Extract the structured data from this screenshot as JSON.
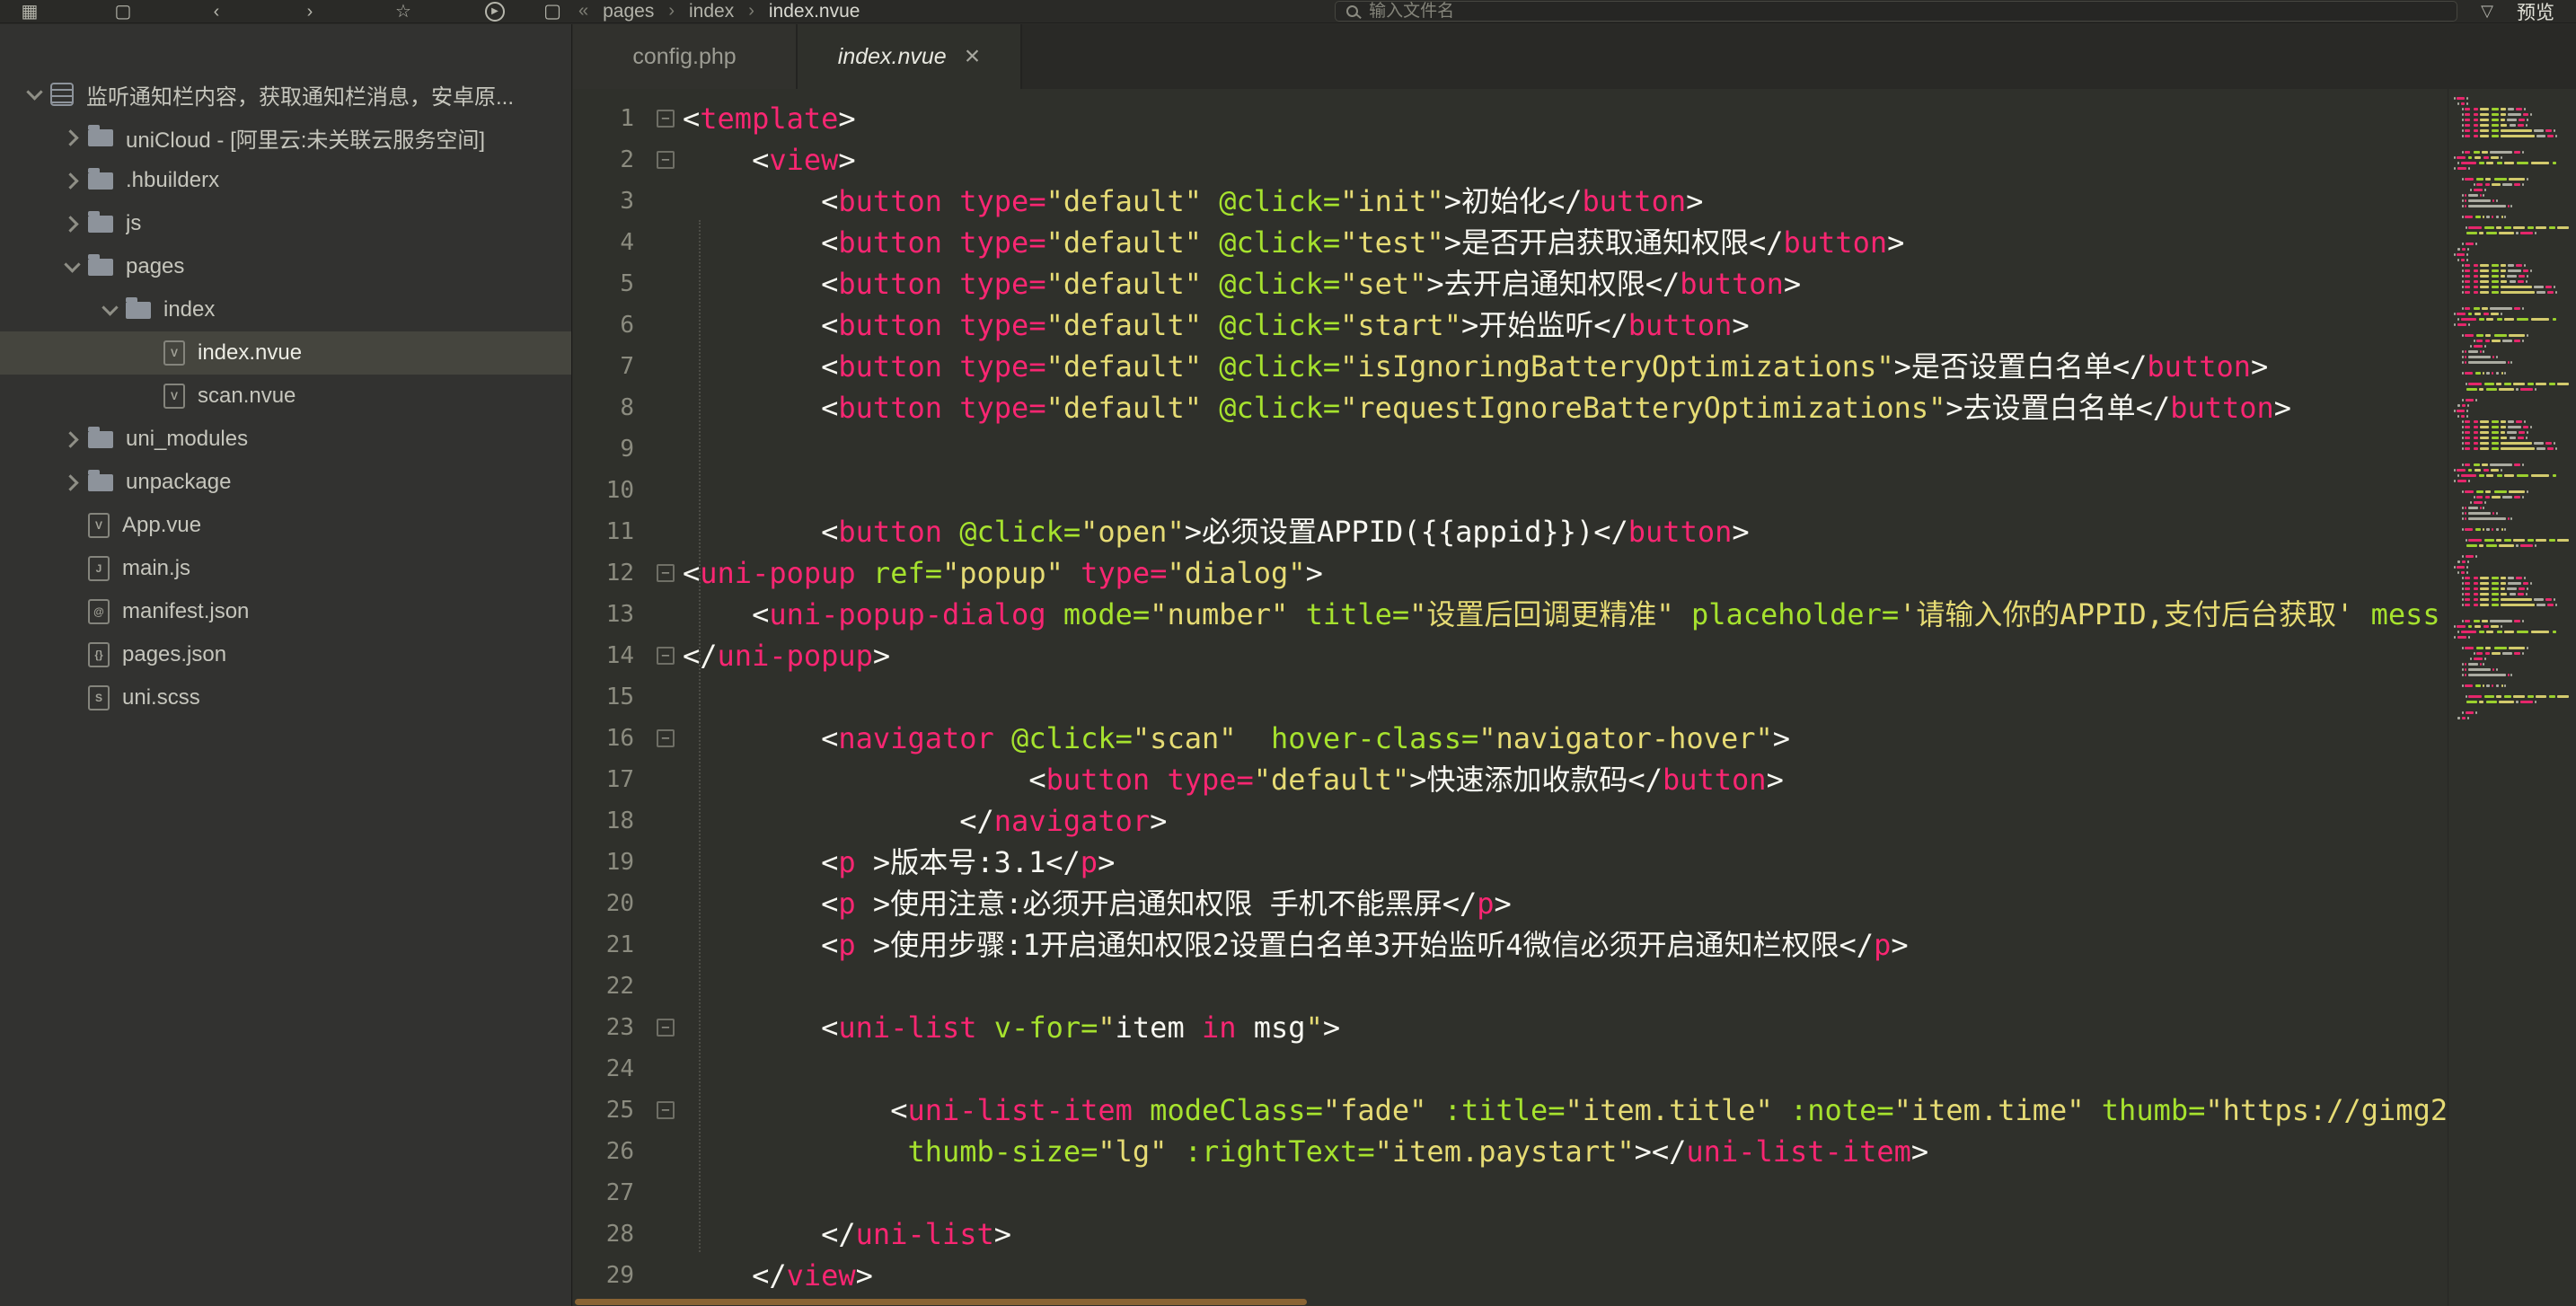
{
  "colors": {
    "tag": "#f92672",
    "attr": "#a6e22e",
    "string": "#e6db74",
    "plain": "#f8f8f2",
    "keyword": "#f92672",
    "lineNumber": "#8b8b7f",
    "editorBg": "#2f302b",
    "sidebarBg": "#323230",
    "selection": "#45453e",
    "scrollbar": "#8a6434"
  },
  "icons": {
    "grid": "▦",
    "doc": "▢",
    "back": "‹",
    "forward": "›",
    "star": "☆",
    "run": "▶",
    "file": "▢",
    "double-chevron": "«",
    "funnel": "▽",
    "breadcrumb-sep": "›",
    "fold": "−",
    "close": "×",
    "file-vue": "V",
    "file-js": "J",
    "file-json": "{}",
    "file-manifest": "@",
    "file-scss": "S"
  },
  "topbar": {
    "breadcrumb": [
      "pages",
      "index",
      "index.nvue"
    ],
    "search": {
      "placeholder": "输入文件名"
    },
    "preview_label": "预览"
  },
  "tabs": [
    {
      "label": "config.php",
      "active": false
    },
    {
      "label": "index.nvue",
      "active": true,
      "closable": true
    }
  ],
  "sidebar": {
    "items": [
      {
        "label": "监听通知栏内容，获取通知栏消息，安卓原...",
        "level": 0,
        "kind": "project",
        "chevron": "down",
        "selected": false
      },
      {
        "label": "uniCloud - [阿里云:未关联云服务空间]",
        "level": 1,
        "kind": "folder",
        "chevron": "right",
        "selected": false
      },
      {
        "label": ".hbuilderx",
        "level": 1,
        "kind": "folder",
        "chevron": "right",
        "selected": false
      },
      {
        "label": "js",
        "level": 1,
        "kind": "folder",
        "chevron": "right",
        "selected": false
      },
      {
        "label": "pages",
        "level": 1,
        "kind": "folder",
        "chevron": "down",
        "selected": false
      },
      {
        "label": "index",
        "level": 2,
        "kind": "folder",
        "chevron": "down",
        "selected": false
      },
      {
        "label": "index.nvue",
        "level": 3,
        "kind": "file-vue",
        "chevron": "none",
        "selected": true
      },
      {
        "label": "scan.nvue",
        "level": 3,
        "kind": "file-vue",
        "chevron": "none",
        "selected": false
      },
      {
        "label": "uni_modules",
        "level": 1,
        "kind": "folder",
        "chevron": "right",
        "selected": false
      },
      {
        "label": "unpackage",
        "level": 1,
        "kind": "folder",
        "chevron": "right",
        "selected": false
      },
      {
        "label": "App.vue",
        "level": 1,
        "kind": "file-vue",
        "chevron": "none",
        "selected": false
      },
      {
        "label": "main.js",
        "level": 1,
        "kind": "file-js",
        "chevron": "none",
        "selected": false
      },
      {
        "label": "manifest.json",
        "level": 1,
        "kind": "file-manifest",
        "chevron": "none",
        "selected": false
      },
      {
        "label": "pages.json",
        "level": 1,
        "kind": "file-json",
        "chevron": "none",
        "selected": false
      },
      {
        "label": "uni.scss",
        "level": 1,
        "kind": "file-scss",
        "chevron": "none",
        "selected": false
      }
    ]
  },
  "editor": {
    "lines": [
      {
        "n": 1,
        "fold": true,
        "tok": [
          [
            "p",
            "<"
          ],
          [
            "t",
            "template"
          ],
          [
            "p",
            ">"
          ]
        ]
      },
      {
        "n": 2,
        "fold": true,
        "tok": [
          [
            "p",
            "    <"
          ],
          [
            "t",
            "view"
          ],
          [
            "p",
            ">"
          ]
        ]
      },
      {
        "n": 3,
        "fold": false,
        "tok": [
          [
            "p",
            "        <"
          ],
          [
            "t",
            "button"
          ],
          [
            "p",
            " "
          ],
          [
            "k",
            "type="
          ],
          [
            "s",
            "\"default\""
          ],
          [
            "p",
            " "
          ],
          [
            "a",
            "@click="
          ],
          [
            "s",
            "\"init\""
          ],
          [
            "p",
            ">初始化</"
          ],
          [
            "t",
            "button"
          ],
          [
            "p",
            ">"
          ]
        ]
      },
      {
        "n": 4,
        "fold": false,
        "tok": [
          [
            "p",
            "        <"
          ],
          [
            "t",
            "button"
          ],
          [
            "p",
            " "
          ],
          [
            "k",
            "type="
          ],
          [
            "s",
            "\"default\""
          ],
          [
            "p",
            " "
          ],
          [
            "a",
            "@click="
          ],
          [
            "s",
            "\"test\""
          ],
          [
            "p",
            ">是否开启获取通知权限</"
          ],
          [
            "t",
            "button"
          ],
          [
            "p",
            ">"
          ]
        ]
      },
      {
        "n": 5,
        "fold": false,
        "tok": [
          [
            "p",
            "        <"
          ],
          [
            "t",
            "button"
          ],
          [
            "p",
            " "
          ],
          [
            "k",
            "type="
          ],
          [
            "s",
            "\"default\""
          ],
          [
            "p",
            " "
          ],
          [
            "a",
            "@click="
          ],
          [
            "s",
            "\"set\""
          ],
          [
            "p",
            ">去开启通知权限</"
          ],
          [
            "t",
            "button"
          ],
          [
            "p",
            ">"
          ]
        ]
      },
      {
        "n": 6,
        "fold": false,
        "tok": [
          [
            "p",
            "        <"
          ],
          [
            "t",
            "button"
          ],
          [
            "p",
            " "
          ],
          [
            "k",
            "type="
          ],
          [
            "s",
            "\"default\""
          ],
          [
            "p",
            " "
          ],
          [
            "a",
            "@click="
          ],
          [
            "s",
            "\"start\""
          ],
          [
            "p",
            ">开始监听</"
          ],
          [
            "t",
            "button"
          ],
          [
            "p",
            ">"
          ]
        ]
      },
      {
        "n": 7,
        "fold": false,
        "tok": [
          [
            "p",
            "        <"
          ],
          [
            "t",
            "button"
          ],
          [
            "p",
            " "
          ],
          [
            "k",
            "type="
          ],
          [
            "s",
            "\"default\""
          ],
          [
            "p",
            " "
          ],
          [
            "a",
            "@click="
          ],
          [
            "s",
            "\"isIgnoringBatteryOptimizations\""
          ],
          [
            "p",
            ">是否设置白名单</"
          ],
          [
            "t",
            "button"
          ],
          [
            "p",
            ">"
          ]
        ]
      },
      {
        "n": 8,
        "fold": false,
        "tok": [
          [
            "p",
            "        <"
          ],
          [
            "t",
            "button"
          ],
          [
            "p",
            " "
          ],
          [
            "k",
            "type="
          ],
          [
            "s",
            "\"default\""
          ],
          [
            "p",
            " "
          ],
          [
            "a",
            "@click="
          ],
          [
            "s",
            "\"requestIgnoreBatteryOptimizations\""
          ],
          [
            "p",
            ">去设置白名单</"
          ],
          [
            "t",
            "button"
          ],
          [
            "p",
            ">"
          ]
        ]
      },
      {
        "n": 9,
        "fold": false,
        "tok": []
      },
      {
        "n": 10,
        "fold": false,
        "tok": []
      },
      {
        "n": 11,
        "fold": false,
        "tok": [
          [
            "p",
            "        <"
          ],
          [
            "t",
            "button"
          ],
          [
            "p",
            " "
          ],
          [
            "a",
            "@click="
          ],
          [
            "s",
            "\"open\""
          ],
          [
            "p",
            ">必须设置APPID({{appid}})</"
          ],
          [
            "t",
            "button"
          ],
          [
            "p",
            ">"
          ]
        ]
      },
      {
        "n": 12,
        "fold": true,
        "tok": [
          [
            "p",
            "<"
          ],
          [
            "t",
            "uni-popup"
          ],
          [
            "p",
            " "
          ],
          [
            "a",
            "ref="
          ],
          [
            "s",
            "\"popup\""
          ],
          [
            "p",
            " "
          ],
          [
            "k",
            "type="
          ],
          [
            "s",
            "\"dialog\""
          ],
          [
            "p",
            ">"
          ]
        ]
      },
      {
        "n": 13,
        "fold": false,
        "tok": [
          [
            "p",
            "    <"
          ],
          [
            "t",
            "uni-popup-dialog"
          ],
          [
            "p",
            " "
          ],
          [
            "a",
            "mode="
          ],
          [
            "s",
            "\"number\""
          ],
          [
            "p",
            " "
          ],
          [
            "a",
            "title="
          ],
          [
            "s",
            "\"设置后回调更精准\""
          ],
          [
            "p",
            " "
          ],
          [
            "a",
            "placeholder="
          ],
          [
            "s",
            "'请输入你的APPID,支付后台获取'"
          ],
          [
            "p",
            " "
          ],
          [
            "a",
            "mess"
          ]
        ]
      },
      {
        "n": 14,
        "fold": true,
        "tok": [
          [
            "p",
            "</"
          ],
          [
            "t",
            "uni-popup"
          ],
          [
            "p",
            ">"
          ]
        ]
      },
      {
        "n": 15,
        "fold": false,
        "tok": []
      },
      {
        "n": 16,
        "fold": true,
        "tok": [
          [
            "p",
            "        <"
          ],
          [
            "t",
            "navigator"
          ],
          [
            "p",
            " "
          ],
          [
            "a",
            "@click="
          ],
          [
            "s",
            "\"scan\""
          ],
          [
            "p",
            "  "
          ],
          [
            "a",
            "hover-class="
          ],
          [
            "s",
            "\"navigator-hover\""
          ],
          [
            "p",
            ">"
          ]
        ]
      },
      {
        "n": 17,
        "fold": false,
        "tok": [
          [
            "p",
            "                    <"
          ],
          [
            "t",
            "button"
          ],
          [
            "p",
            " "
          ],
          [
            "k",
            "type="
          ],
          [
            "s",
            "\"default\""
          ],
          [
            "p",
            ">快速添加收款码</"
          ],
          [
            "t",
            "button"
          ],
          [
            "p",
            ">"
          ]
        ]
      },
      {
        "n": 18,
        "fold": false,
        "tok": [
          [
            "p",
            "                </"
          ],
          [
            "t",
            "navigator"
          ],
          [
            "p",
            ">"
          ]
        ]
      },
      {
        "n": 19,
        "fold": false,
        "tok": [
          [
            "p",
            "        <"
          ],
          [
            "t",
            "p"
          ],
          [
            "p",
            " >版本号:3.1</"
          ],
          [
            "t",
            "p"
          ],
          [
            "p",
            ">"
          ]
        ]
      },
      {
        "n": 20,
        "fold": false,
        "tok": [
          [
            "p",
            "        <"
          ],
          [
            "t",
            "p"
          ],
          [
            "p",
            " >使用注意:必须开启通知权限 手机不能黑屏</"
          ],
          [
            "t",
            "p"
          ],
          [
            "p",
            ">"
          ]
        ]
      },
      {
        "n": 21,
        "fold": false,
        "tok": [
          [
            "p",
            "        <"
          ],
          [
            "t",
            "p"
          ],
          [
            "p",
            " >使用步骤:1开启通知权限2设置白名单3开始监听4微信必须开启通知栏权限</"
          ],
          [
            "t",
            "p"
          ],
          [
            "p",
            ">"
          ]
        ]
      },
      {
        "n": 22,
        "fold": false,
        "tok": []
      },
      {
        "n": 23,
        "fold": true,
        "tok": [
          [
            "p",
            "        <"
          ],
          [
            "t",
            "uni-list"
          ],
          [
            "p",
            " "
          ],
          [
            "a",
            "v-for="
          ],
          [
            "s",
            "\""
          ],
          [
            "p",
            "item "
          ],
          [
            "k",
            "in"
          ],
          [
            "p",
            " msg"
          ],
          [
            "s",
            "\""
          ],
          [
            "p",
            ">"
          ]
        ]
      },
      {
        "n": 24,
        "fold": false,
        "tok": []
      },
      {
        "n": 25,
        "fold": true,
        "tok": [
          [
            "p",
            "            <"
          ],
          [
            "t",
            "uni-list-item"
          ],
          [
            "p",
            " "
          ],
          [
            "a",
            "modeClass="
          ],
          [
            "s",
            "\"fade\""
          ],
          [
            "p",
            " "
          ],
          [
            "a",
            ":title="
          ],
          [
            "s",
            "\"item.title\""
          ],
          [
            "p",
            " "
          ],
          [
            "a",
            ":note="
          ],
          [
            "s",
            "\"item.time\""
          ],
          [
            "p",
            " "
          ],
          [
            "a",
            "thumb="
          ],
          [
            "s",
            "\"https://gimg2"
          ]
        ]
      },
      {
        "n": 26,
        "fold": false,
        "tok": [
          [
            "p",
            "             "
          ],
          [
            "a",
            "thumb-size="
          ],
          [
            "s",
            "\"lg\""
          ],
          [
            "p",
            " "
          ],
          [
            "a",
            ":rightText="
          ],
          [
            "s",
            "\"item.paystart\""
          ],
          [
            "p",
            "></"
          ],
          [
            "t",
            "uni-list-item"
          ],
          [
            "p",
            ">"
          ]
        ]
      },
      {
        "n": 27,
        "fold": false,
        "tok": []
      },
      {
        "n": 28,
        "fold": false,
        "tok": [
          [
            "p",
            "        </"
          ],
          [
            "t",
            "uni-list"
          ],
          [
            "p",
            ">"
          ]
        ]
      },
      {
        "n": 29,
        "fold": false,
        "tok": [
          [
            "p",
            "    </"
          ],
          [
            "t",
            "view"
          ],
          [
            "p",
            ">"
          ]
        ]
      }
    ]
  }
}
